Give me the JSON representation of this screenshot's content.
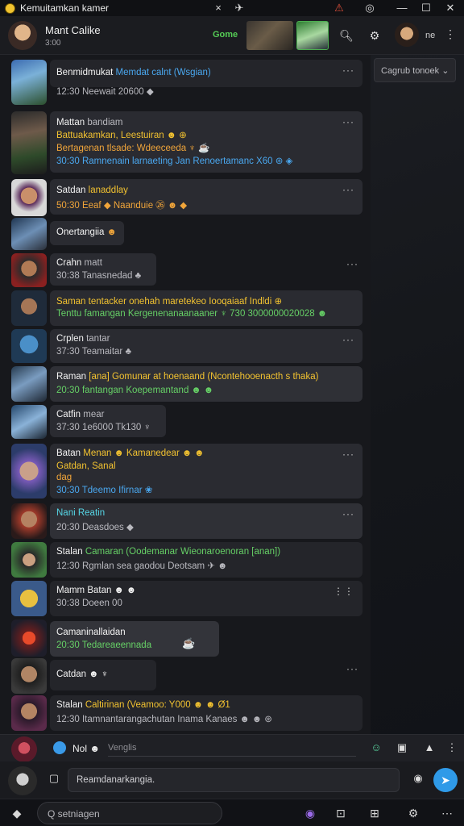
{
  "window": {
    "title": "Kemuitamkan kamer",
    "buttons": [
      "×",
      "✈",
      "—",
      "☐",
      "✕"
    ]
  },
  "header": {
    "name": "Mant Calike",
    "subtitle": "3:00",
    "green_label": "Gome",
    "count": "ne",
    "more": "⋮"
  },
  "side_panel": {
    "dropdown": "Cagrub tonoek ⌄"
  },
  "messages": [
    {
      "name": "Benmidmukat",
      "text": "Memdat calnt (Wsgian)",
      "more": "···",
      "lines": [
        "12:30  Neewait 20600 ◆"
      ]
    },
    {
      "name": "Mattan",
      "name2": "bandiam",
      "more": "···",
      "lines": [
        "Battuakamkan, Leestuiran ☻ ⊕",
        "Bertagenan tlsade: Wdeeceeda ♆ ☕",
        "30:30  Ramnenain larnaeting Jan Renoertamanc X60 ⊛ ◈"
      ]
    },
    {
      "name": "Satdan",
      "text": "lanaddlay",
      "more": "···",
      "lines": [
        "50:30  Eeaf ◆ Naanduie ㉖ ☻ ◆"
      ]
    },
    {
      "name": "Onertangiia",
      "emoji": "☻",
      "lines": []
    },
    {
      "name": "Crahn",
      "text": "matt",
      "more": "···",
      "lines": [
        "30:38  Tanasnedad ♣"
      ]
    },
    {
      "name": "Saman",
      "text": "tentacker onehah maretekeo Iooqaiaaf Indldi ⊕",
      "lines": [
        "Tenttu famangan Kergenenanaanaaner ♆ 730 3000000020028 ☻"
      ]
    },
    {
      "name": "Crplen",
      "text": "tantar",
      "more": "···",
      "lines": [
        "37:30  Teamaitar ♣"
      ]
    },
    {
      "name": "Raman",
      "text": "[ana] Gomunar at hoenaand (Ncontehooenacth s thaka)",
      "lines": [
        "20:30  fantangan Koepemantand ☻ ☻"
      ]
    },
    {
      "name": "Catfin",
      "text": "mear",
      "lines": [
        "37:30  1e6000 Tk130 ♆"
      ]
    },
    {
      "name": "Batan",
      "text": "Menan ☻ Kamanedear ☻ ☻",
      "more": "···",
      "lines": [
        "Gatdan, Sanal",
        "dag",
        "30:30  Tdeemo Ifirnar ❀"
      ]
    },
    {
      "name": "Nani Reatin",
      "more": "···",
      "lines": [
        "20:30  Deasdoes ◆"
      ]
    },
    {
      "name": "Stalan",
      "text": "Camaran (Oodemanar Wieonaroenoran [anan])",
      "lines": [
        "12:30  Rgmlan sea gaodou Deotsam ✈ ☻"
      ]
    },
    {
      "name": "Mamm",
      "text": "Batan ☻ ☻",
      "more": "⋮⋮",
      "lines": [
        "30:38  Doeen 00"
      ]
    },
    {
      "name": "Camaninallaidan",
      "lines": [
        "20:30  Tedareaeennada"
      ],
      "emoji": "☕"
    },
    {
      "name": "Catdan ☻ ♆",
      "more": "···",
      "lines": []
    },
    {
      "name": "Stalan",
      "text": "Caltirinan (Veamoo: Y000 ☻ ☻ Ø1",
      "lines": [
        "12:30  Itamnantarangachutan Inama Kanaes ☻ ☻ ⊛"
      ]
    }
  ],
  "composer": {
    "label": "Nol ☻",
    "placeholder": "Venglis"
  },
  "input": {
    "placeholder": "Reamdanarkangia.",
    "send": "➤"
  },
  "bottom": {
    "search": "Q setniagen"
  },
  "colors": {
    "accent": "#2f9ae8",
    "green": "#66d066",
    "yellow": "#f2c230",
    "background": "#17181c"
  }
}
